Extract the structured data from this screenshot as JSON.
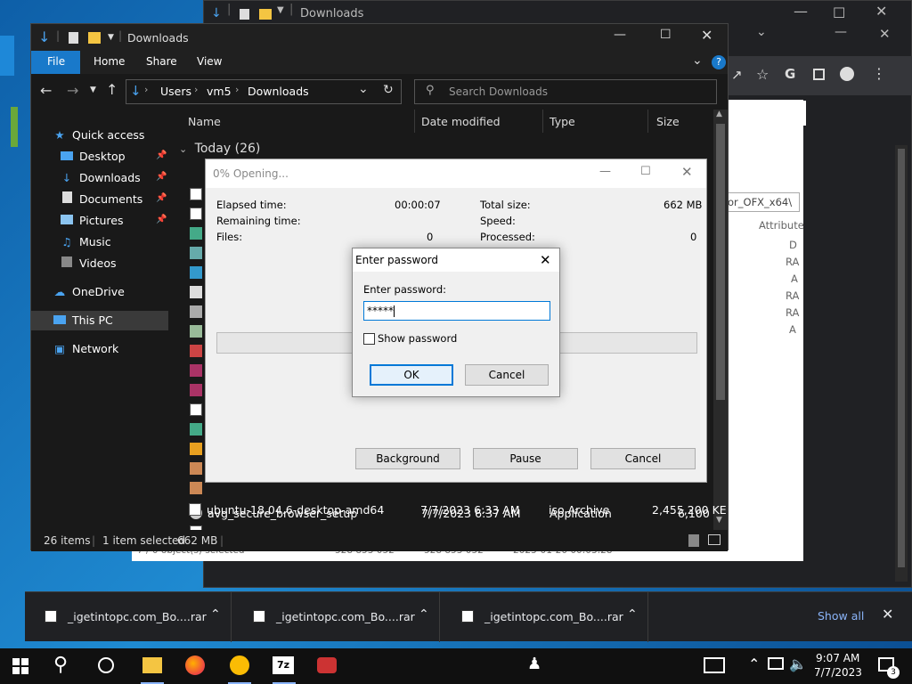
{
  "background_chrome": {
    "title": "Downloads",
    "path_fragment": "or_OFX_x64\\",
    "attribute_header": "Attribute",
    "attribute_values": [
      "D",
      "RA",
      "A",
      "RA",
      "RA",
      "A"
    ],
    "status_fragment": "7 / 0 object(s) selected",
    "status_values": [
      "528 853 052",
      "528 853 052",
      "2023-01-20 00:03:28"
    ]
  },
  "explorer": {
    "title": "Downloads",
    "ribbon": {
      "file": "File",
      "home": "Home",
      "share": "Share",
      "view": "View"
    },
    "breadcrumb": [
      "Users",
      "vm5",
      "Downloads"
    ],
    "search_placeholder": "Search Downloads",
    "nav": {
      "quick_access": "Quick access",
      "desktop": "Desktop",
      "downloads": "Downloads",
      "documents": "Documents",
      "pictures": "Pictures",
      "music": "Music",
      "videos": "Videos",
      "onedrive": "OneDrive",
      "this_pc": "This PC",
      "network": "Network"
    },
    "columns": {
      "name": "Name",
      "date": "Date modified",
      "type": "Type",
      "size": "Size"
    },
    "group": "Today (26)",
    "files": [
      {
        "name": "avg_secure_browser_setup",
        "date": "7/7/2023 6:37 AM",
        "type": "Application",
        "size": "6,100 KE"
      },
      {
        "name": "ubuntu-18.04.6-desktop-amd64",
        "date": "7/7/2023 6:33 AM",
        "type": "iso Archive",
        "size": "2,455,200 KE"
      }
    ],
    "status": {
      "count": "26 items",
      "selected": "1 item selected",
      "size": "662 MB"
    }
  },
  "progress": {
    "title": "0% Opening...",
    "elapsed_label": "Elapsed time:",
    "elapsed_value": "00:00:07",
    "remaining_label": "Remaining time:",
    "files_label": "Files:",
    "files_value": "0",
    "total_label": "Total size:",
    "total_value": "662 MB",
    "speed_label": "Speed:",
    "processed_label": "Processed:",
    "processed_value": "0",
    "percent": 0,
    "background_btn": "Background",
    "pause_btn": "Pause",
    "cancel_btn": "Cancel"
  },
  "password": {
    "title": "Enter password",
    "label": "Enter password:",
    "value": "*****",
    "show_label": "Show password",
    "ok": "OK",
    "cancel": "Cancel"
  },
  "downloads_bar": {
    "items": [
      "_igetintopc.com_Bo....rar",
      "_igetintopc.com_Bo....rar",
      "_igetintopc.com_Bo....rar"
    ],
    "show_all": "Show all"
  },
  "taskbar": {
    "time": "9:07 AM",
    "date": "7/7/2023",
    "notifications": "3"
  },
  "colors": {
    "accent": "#1979ca",
    "taskbar": "#101010",
    "explorer_bg": "#191919",
    "dialog_bg": "#f0f0f0"
  }
}
